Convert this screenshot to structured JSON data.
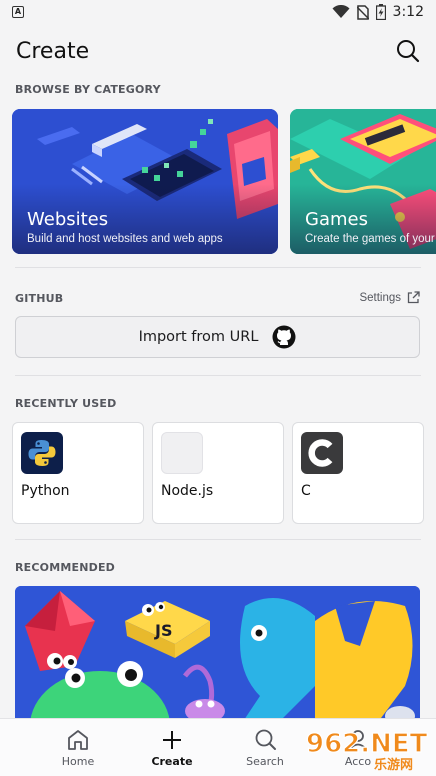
{
  "status_bar": {
    "app_indicator": "A",
    "time": "3:12",
    "icons": [
      "wifi-icon",
      "no-sim-icon",
      "battery-charging-icon"
    ]
  },
  "header": {
    "title": "Create",
    "search_icon": "search-icon"
  },
  "browse": {
    "label": "BROWSE BY CATEGORY",
    "categories": [
      {
        "title": "Websites",
        "subtitle": "Build and host websites and web apps"
      },
      {
        "title": "Games",
        "subtitle": "Create the games of your"
      }
    ]
  },
  "github": {
    "label": "GITHUB",
    "settings_label": "Settings",
    "settings_icon": "external-link-icon",
    "import_label": "Import from URL",
    "import_icon": "github-icon"
  },
  "recent": {
    "label": "RECENTLY USED",
    "items": [
      {
        "name": "Python",
        "icon": "python-icon"
      },
      {
        "name": "Node.js",
        "icon": "nodejs-icon"
      },
      {
        "name": "C",
        "icon": "c-language-icon"
      }
    ]
  },
  "recommended": {
    "label": "RECOMMENDED",
    "art_text": "JS"
  },
  "bottom_nav": {
    "items": [
      {
        "label": "Home",
        "icon": "home-icon",
        "active": false
      },
      {
        "label": "Create",
        "icon": "plus-icon",
        "active": true
      },
      {
        "label": "Search",
        "icon": "search-icon",
        "active": false
      },
      {
        "label": "Acco",
        "icon": "account-icon",
        "active": false
      }
    ]
  },
  "watermark": {
    "text": "962.NET",
    "subtext": "乐游网"
  },
  "colors": {
    "background": "#f4f4f5",
    "websites_card": "#2d4fd1",
    "games_card": "#27b598",
    "recommended_card": "#2f55d6"
  }
}
